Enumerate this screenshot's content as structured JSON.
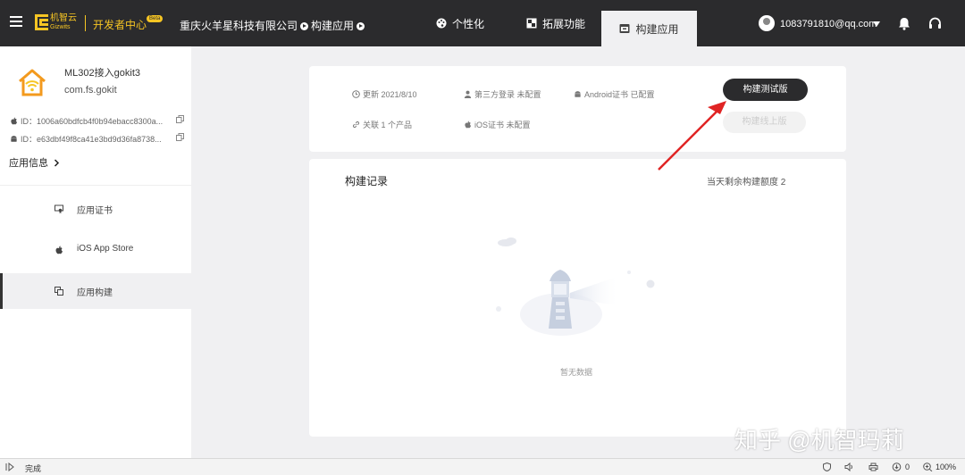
{
  "header": {
    "logo_text": "机智云",
    "logo_sub": "Gizwits",
    "dev_center": "开发者中心",
    "beta": "Beta",
    "company": "重庆火羊星科技有限公司",
    "breadcrumb_current": "构建应用",
    "tabs": [
      {
        "label": "个性化",
        "icon": "palette-icon"
      },
      {
        "label": "拓展功能",
        "icon": "extension-icon"
      },
      {
        "label": "构建应用",
        "icon": "build-box-icon"
      }
    ],
    "user_email": "1083791810@qq.com"
  },
  "sidebar": {
    "app_name": "ML302接入gokit3",
    "app_package": "com.fs.gokit",
    "ios_id": "ID：1006a60bdfcb4f0b94ebacc8300a...",
    "android_id": "ID：e63dbf49f8ca41e3bd9d36fa8738...",
    "app_info": "应用信息",
    "items": [
      {
        "label": "应用证书",
        "icon": "certificate-icon"
      },
      {
        "label": "iOS App Store",
        "icon": "apple-icon"
      },
      {
        "label": "应用构建",
        "icon": "copy-build-icon"
      }
    ]
  },
  "overview": {
    "updated": "更新  2021/8/10",
    "third_party": "第三方登录  未配置",
    "android_cert": "Android证书  已配置",
    "related": "关联 1 个产品",
    "ios_cert": "iOS证书  未配置",
    "build_test_button": "构建测试版",
    "build_release_button": "构建线上版"
  },
  "records": {
    "title": "构建记录",
    "quota": "当天剩余构建额度 2",
    "empty": "暂无数据"
  },
  "watermark": "知乎 @机智玛莉",
  "statusbar": {
    "done": "完成",
    "count": "0",
    "zoom": "100%"
  },
  "colors": {
    "topbar": "#2b2b2d",
    "brand_yellow": "#f6c523",
    "arrow_red": "#e02424",
    "page_bg": "#f0f0f2"
  }
}
